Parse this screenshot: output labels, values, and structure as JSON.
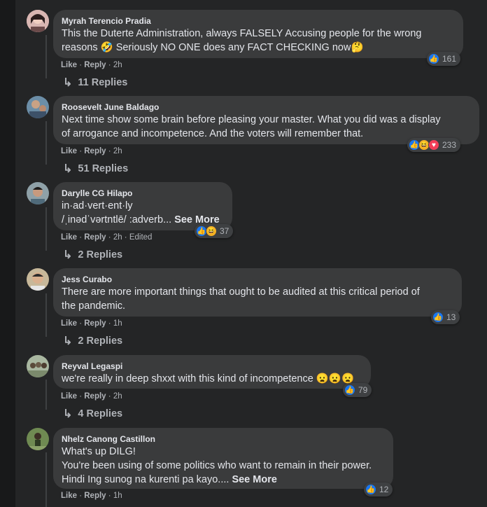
{
  "comments": [
    {
      "author": "Myrah Terencio Pradia",
      "lines": [
        "This the Duterte Administration, always FALSELY Accusing people for the wrong",
        "reasons 🤣 Seriously NO ONE does any FACT CHECKING now🤔"
      ],
      "like": "Like",
      "reply": "Reply",
      "time": "2h",
      "edited": "",
      "reaction_count": "161",
      "replies": "11 Replies"
    },
    {
      "author": "Roosevelt June Baldago",
      "lines": [
        "Next time show some brain before pleasing your master. What you did was a display",
        "of arrogance and incompetence. And the voters will remember that."
      ],
      "like": "Like",
      "reply": "Reply",
      "time": "2h",
      "edited": "",
      "reaction_count": "233",
      "replies": "51 Replies"
    },
    {
      "author": "Darylle CG Hilapo",
      "lines": [
        "in·ad·vert·ent·ly",
        "/ˌinədˈvərtntlē/ :adverb... "
      ],
      "see_more": "See More",
      "like": "Like",
      "reply": "Reply",
      "time": "2h",
      "edited": "Edited",
      "reaction_count": "37",
      "replies": "2 Replies"
    },
    {
      "author": "Jess Curabo",
      "lines": [
        "There are more important things that ought to be audited at this critical period of",
        "the pandemic."
      ],
      "like": "Like",
      "reply": "Reply",
      "time": "1h",
      "edited": "",
      "reaction_count": "13",
      "replies": "2 Replies"
    },
    {
      "author": "Reyval Legaspi",
      "lines": [
        "we're really in deep shxxt with this kind of incompetence 😦😦😦"
      ],
      "like": "Like",
      "reply": "Reply",
      "time": "2h",
      "edited": "",
      "reaction_count": "79",
      "replies": "4 Replies"
    },
    {
      "author": "Nhelz Canong Castillon",
      "lines": [
        "What's up DILG!",
        "You're been using of some politics who want to remain in their power.",
        "Hindi Ing sunog na kurenti pa kayo.... "
      ],
      "see_more": "See More",
      "like": "Like",
      "reply": "Reply",
      "time": "1h",
      "edited": "",
      "reaction_count": "12",
      "replies": ""
    }
  ],
  "colors": {
    "like": "#1877f2",
    "haha": "#f7b125",
    "love": "#f33e58",
    "bubble": "#3a3b3c",
    "panel": "#242526"
  },
  "icons": {
    "like": "thumbs-up-icon",
    "haha": "haha-icon",
    "love": "heart-icon",
    "reply_arrow": "reply-arrow-icon"
  }
}
